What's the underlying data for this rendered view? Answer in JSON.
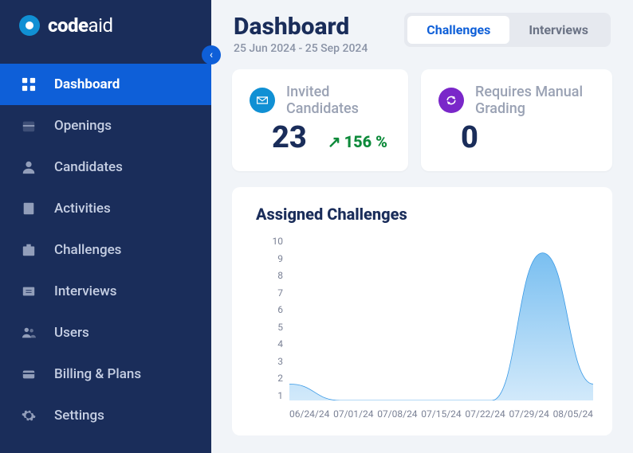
{
  "logo": {
    "text1": "code",
    "text2": "aid"
  },
  "sidebar": {
    "items": [
      {
        "label": "Dashboard"
      },
      {
        "label": "Openings"
      },
      {
        "label": "Candidates"
      },
      {
        "label": "Activities"
      },
      {
        "label": "Challenges"
      },
      {
        "label": "Interviews"
      },
      {
        "label": "Users"
      },
      {
        "label": "Billing & Plans"
      },
      {
        "label": "Settings"
      }
    ]
  },
  "header": {
    "title": "Dashboard",
    "range": "25 Jun 2024 - 25 Sep 2024",
    "tabs": [
      {
        "label": "Challenges"
      },
      {
        "label": "Interviews"
      }
    ]
  },
  "cards": {
    "invited": {
      "label": "Invited Candidates",
      "value": "23",
      "change": "156 %",
      "icon_bg": "#1090d4"
    },
    "manual": {
      "label": "Requires Manual Grading",
      "value": "0",
      "icon_bg": "#7a27c9"
    }
  },
  "chart_data": {
    "type": "area",
    "title": "Assigned Challenges",
    "ylabel": "",
    "xlabel": "",
    "ylim": [
      0,
      10
    ],
    "y_ticks": [
      "10",
      "9",
      "8",
      "7",
      "6",
      "5",
      "4",
      "3",
      "2",
      "1"
    ],
    "categories": [
      "06/24/24",
      "07/01/24",
      "07/08/24",
      "07/15/24",
      "07/22/24",
      "07/29/24",
      "08/05/24"
    ],
    "values": [
      1,
      0,
      0,
      0,
      0,
      9,
      1
    ]
  }
}
